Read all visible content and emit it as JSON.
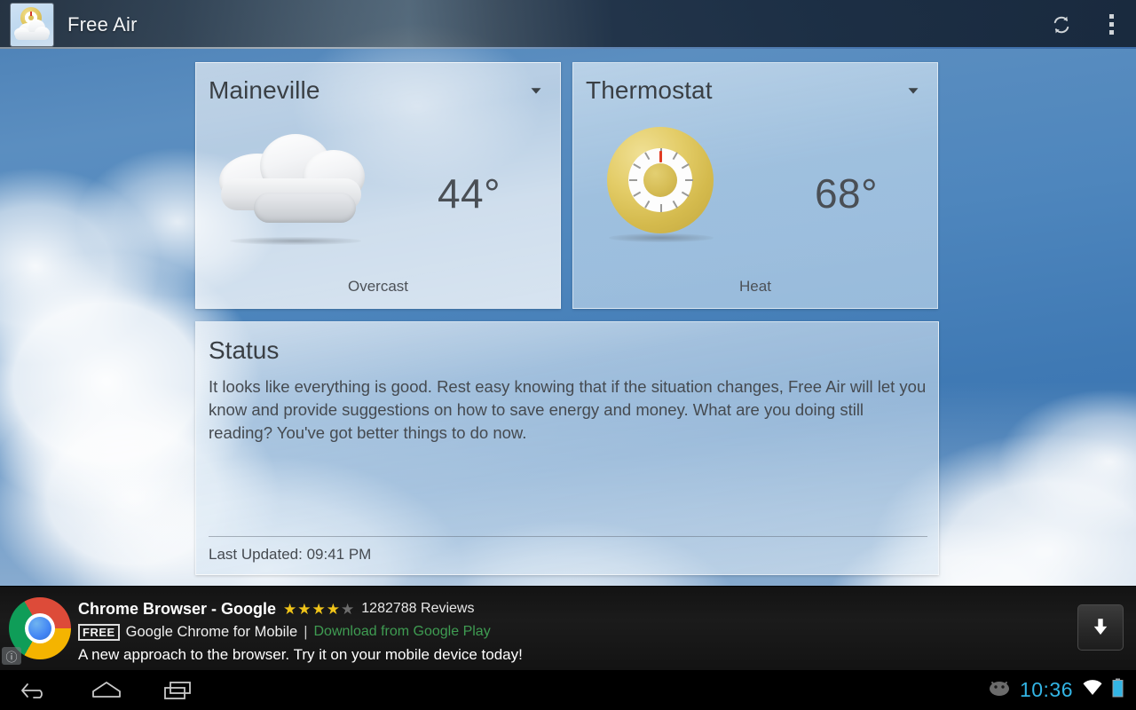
{
  "app": {
    "title": "Free Air",
    "icon": "app-logo-thermostat-cloud-icon",
    "refresh_icon": "refresh-icon",
    "overflow_icon": "overflow-menu-icon"
  },
  "weather_card": {
    "title": "Maineville",
    "dropdown_icon": "chevron-down-icon",
    "condition_icon": "overcast-cloud-icon",
    "temperature": "44°",
    "condition": "Overcast"
  },
  "thermostat_card": {
    "title": "Thermostat",
    "dropdown_icon": "chevron-down-icon",
    "device_icon": "thermostat-dial-icon",
    "temperature": "68°",
    "mode": "Heat"
  },
  "status_card": {
    "title": "Status",
    "message": "It looks like everything is good. Rest easy knowing that if the situation changes, Free Air will let you know and provide suggestions on how to save energy and money. What are you doing still reading? You've got better things to do now.",
    "last_updated": "Last Updated: 09:41 PM"
  },
  "ad": {
    "logo_icon": "chrome-logo-icon",
    "info_icon": "ad-info-icon",
    "headline": "Chrome Browser - Google",
    "stars_filled": 4,
    "stars_total": 5,
    "reviews": "1282788 Reviews",
    "price_badge": "FREE",
    "subtitle": "Google Chrome for Mobile",
    "separator": "|",
    "link": "Download from Google Play",
    "description": "A new approach to the browser. Try it on your mobile device today!",
    "download_icon": "download-arrow-icon"
  },
  "system": {
    "back_icon": "back-icon",
    "home_icon": "home-icon",
    "recents_icon": "recent-apps-icon",
    "notification_icon": "android-bean-icon",
    "time": "10:36",
    "wifi_icon": "wifi-icon",
    "battery_icon": "battery-icon"
  },
  "colors": {
    "accent_blue": "#33b5e5",
    "link_green": "#3f9c52",
    "star_gold": "#f0c419",
    "thermostat_gold": "#d6bd55",
    "needle_red": "#e03a22"
  }
}
